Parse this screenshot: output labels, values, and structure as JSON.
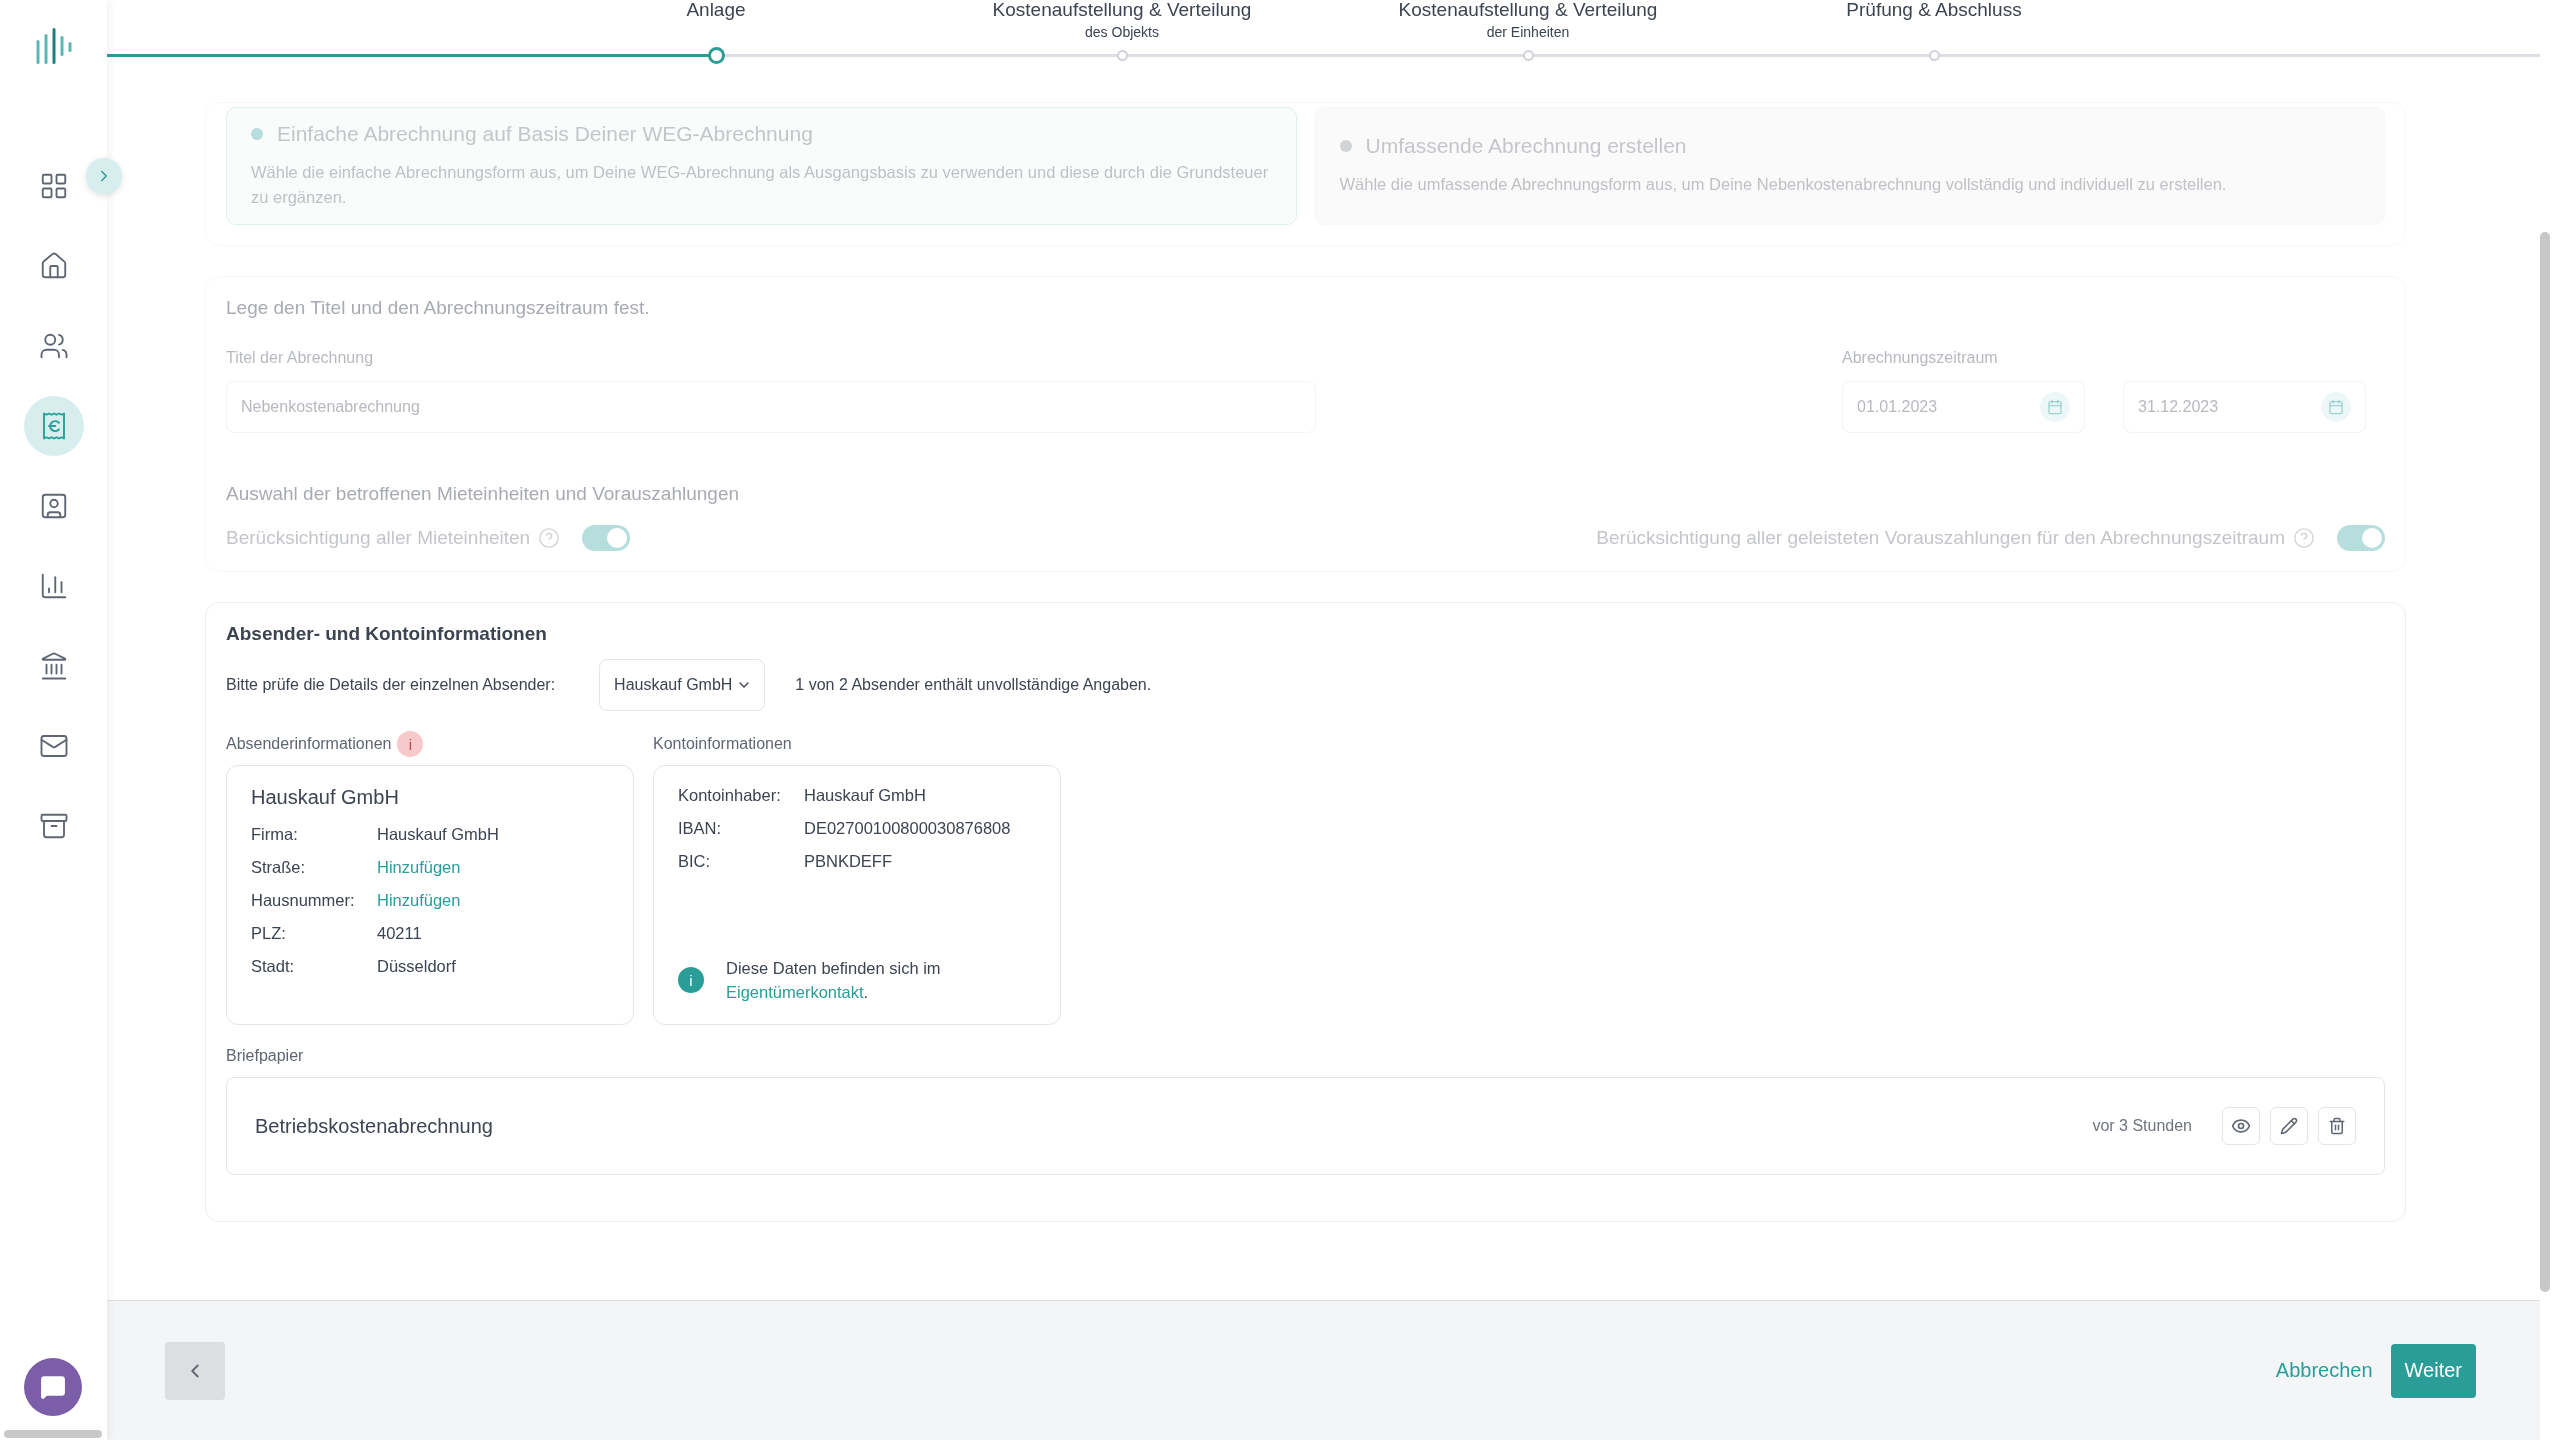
{
  "sidebar": {
    "items": [
      {
        "kind": "dashboard",
        "selected": false
      },
      {
        "kind": "home",
        "selected": false
      },
      {
        "kind": "people",
        "selected": false
      },
      {
        "kind": "billing",
        "selected": true
      },
      {
        "kind": "contact",
        "selected": false
      },
      {
        "kind": "chart",
        "selected": false
      },
      {
        "kind": "bank",
        "selected": false
      },
      {
        "kind": "mail",
        "selected": false
      },
      {
        "kind": "archive",
        "selected": false
      }
    ]
  },
  "stepper": {
    "steps": [
      {
        "label": "Anlage",
        "selected": true
      },
      {
        "label": "Kostenaufstellung & Verteilung",
        "sublabel": "des Objekts",
        "selected": false
      },
      {
        "label": "Kostenaufstellung & Verteilung",
        "sublabel": "der Einheiten",
        "selected": false
      },
      {
        "label": "Prüfung & Abschluss",
        "selected": false
      }
    ]
  },
  "billing_type": {
    "disabled": true,
    "options": [
      {
        "title": "Einfache Abrechnung auf Basis Deiner WEG-Abrechnung",
        "description": "Wähle die einfache Abrechnungsform aus, um Deine WEG-Abrechnung als Ausgangsbasis zu verwenden und diese durch die Grundsteuer zu ergänzen.",
        "selected": true
      },
      {
        "title": "Umfassende Abrechnung erstellen",
        "description": "Wähle die umfassende Abrechnungsform aus, um Deine Nebenkostenabrechnung vollständig und individuell zu erstellen.",
        "selected": false
      }
    ]
  },
  "period_section": {
    "disabled": true,
    "heading": "Lege den Titel und den Abrechnungszeitraum fest.",
    "title_field": {
      "label": "Titel der Abrechnung",
      "value": "Nebenkostenabrechnung"
    },
    "period": {
      "label": "Abrechnungszeitraum",
      "from": "01.01.2023",
      "to": "31.12.2023"
    },
    "units_heading": "Auswahl der betroffenen Mieteinheiten und Vorauszahlungen",
    "toggles": [
      {
        "label": "Berücksichtigung aller Mieteinheiten",
        "on": true
      },
      {
        "label": "Berücksichtigung aller geleisteten Vorauszahlungen für den Abrechnungszeitraum",
        "on": true
      }
    ]
  },
  "sender_section": {
    "heading": "Absender- und Kontoinformationen",
    "prompt": "Bitte prüfe die Details der einzelnen Absender:",
    "sender_select": "Hauskauf GmbH",
    "notice": "1 von 2 Absender enthält unvollständige Angaben.",
    "sender_info": {
      "heading": "Absenderinformationen",
      "warning_mark": "i",
      "name": "Hauskauf GmbH",
      "fields": [
        {
          "label": "Firma:",
          "value": "Hauskauf GmbH",
          "kind": "text"
        },
        {
          "label": "Straße:",
          "value": "Hinzufügen",
          "kind": "link"
        },
        {
          "label": "Hausnummer:",
          "value": "Hinzufügen",
          "kind": "link"
        },
        {
          "label": "PLZ:",
          "value": "40211",
          "kind": "text"
        },
        {
          "label": "Stadt:",
          "value": "Düsseldorf",
          "kind": "text"
        }
      ]
    },
    "account_info": {
      "heading": "Kontoinformationen",
      "fields": [
        {
          "label": "Kontoinhaber:",
          "value": "Hauskauf GmbH"
        },
        {
          "label": "IBAN:",
          "value": "DE02700100800030876808"
        },
        {
          "label": "BIC:",
          "value": "PBNKDEFF"
        }
      ],
      "note_mark": "i",
      "note": "Diese Daten befinden sich im",
      "note_link": "Eigentümerkontakt",
      "note_end": "."
    },
    "letterhead": {
      "label": "Briefpapier",
      "name": "Betriebskostenabrechnung",
      "time": "vor 3 Stunden"
    }
  },
  "footer": {
    "cancel": "Abbrechen",
    "next": "Weiter"
  }
}
